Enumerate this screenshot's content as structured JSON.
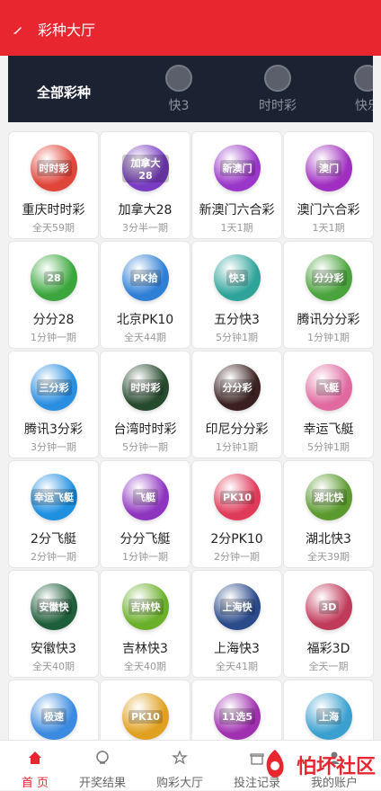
{
  "header": {
    "title": "彩种大厅"
  },
  "category_bar": {
    "all_label": "全部彩种",
    "tabs": [
      {
        "label": "快3"
      },
      {
        "label": "时时彩"
      },
      {
        "label": "快乐"
      }
    ]
  },
  "lotteries": [
    {
      "name": "重庆时时彩",
      "sub": "全天59期",
      "color": "#e0453a",
      "badge": "时时彩"
    },
    {
      "name": "加拿大28",
      "sub": "3分半一期",
      "color": "#7a3cc2",
      "badge": "加拿大28"
    },
    {
      "name": "新澳门六合彩",
      "sub": "1天1期",
      "color": "#9a36c9",
      "badge": "新澳门"
    },
    {
      "name": "澳门六合彩",
      "sub": "1天1期",
      "color": "#a02ec0",
      "badge": "澳门"
    },
    {
      "name": "分分28",
      "sub": "1分钟一期",
      "color": "#3aa63c",
      "badge": "28"
    },
    {
      "name": "北京PK10",
      "sub": "全天44期",
      "color": "#2f7fd6",
      "badge": "PK拾"
    },
    {
      "name": "五分快3",
      "sub": "5分钟1期",
      "color": "#2fa39a",
      "badge": "快3"
    },
    {
      "name": "腾讯分分彩",
      "sub": "1分钟1期",
      "color": "#4aa33c",
      "badge": "分分彩"
    },
    {
      "name": "腾讯3分彩",
      "sub": "3分钟一期",
      "color": "#2a8ee0",
      "badge": "三分彩"
    },
    {
      "name": "台湾时时彩",
      "sub": "5分钟一期",
      "color": "#264a2e",
      "badge": "时时彩"
    },
    {
      "name": "印尼分分彩",
      "sub": "1分钟1期",
      "color": "#3a2020",
      "badge": "分分彩"
    },
    {
      "name": "幸运飞艇",
      "sub": "5分钟1期",
      "color": "#e06aa0",
      "badge": "飞艇"
    },
    {
      "name": "2分飞艇",
      "sub": "2分钟一期",
      "color": "#1f8fe0",
      "badge": "幸运飞艇"
    },
    {
      "name": "分分飞艇",
      "sub": "1分钟一期",
      "color": "#8e35c0",
      "badge": "飞艇"
    },
    {
      "name": "2分PK10",
      "sub": "2分钟一期",
      "color": "#e03a5a",
      "badge": "PK10"
    },
    {
      "name": "湖北快3",
      "sub": "全天39期",
      "color": "#5a9a2e",
      "badge": "湖北快"
    },
    {
      "name": "安徽快3",
      "sub": "全天40期",
      "color": "#1f5e3a",
      "badge": "安徽快"
    },
    {
      "name": "吉林快3",
      "sub": "全天40期",
      "color": "#6ab02a",
      "badge": "吉林快"
    },
    {
      "name": "上海快3",
      "sub": "全天41期",
      "color": "#2a4a8a",
      "badge": "上海快"
    },
    {
      "name": "福彩3D",
      "sub": "全天一期",
      "color": "#c03a5a",
      "badge": "3D"
    },
    {
      "name": "",
      "sub": "",
      "color": "#3a8ae0",
      "badge": "极速"
    },
    {
      "name": "",
      "sub": "",
      "color": "#e0a020",
      "badge": "PK10"
    },
    {
      "name": "",
      "sub": "",
      "color": "#a030b0",
      "badge": "11选5"
    },
    {
      "name": "",
      "sub": "",
      "color": "#3aa0d0",
      "badge": "上海"
    }
  ],
  "tabbar": {
    "items": [
      {
        "label": "首 页"
      },
      {
        "label": "开奖结果"
      },
      {
        "label": "购彩大厅"
      },
      {
        "label": "投注记录"
      },
      {
        "label": "我的账户"
      }
    ]
  },
  "watermark": "怕坏社区",
  "colors": {
    "brand_red": "#e8262f",
    "dark_bar": "#1b2232"
  }
}
